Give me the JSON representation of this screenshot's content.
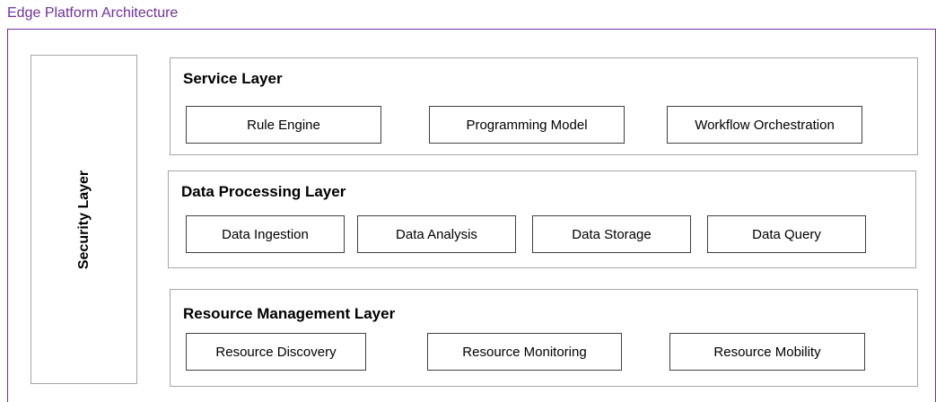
{
  "title": "Edge Platform Architecture",
  "colors": {
    "title": "#7030a0",
    "outer_border": "#7030a0",
    "layer_border": "#a6a6a6",
    "component_border": "#404040"
  },
  "security_layer": {
    "label": "Security Layer"
  },
  "layers": {
    "service": {
      "title": "Service Layer",
      "components": [
        "Rule Engine",
        "Programming Model",
        "Workflow Orchestration"
      ]
    },
    "data_processing": {
      "title": "Data Processing Layer",
      "components": [
        "Data Ingestion",
        "Data Analysis",
        "Data Storage",
        "Data Query"
      ]
    },
    "resource_management": {
      "title": "Resource Management Layer",
      "components": [
        "Resource Discovery",
        "Resource Monitoring",
        "Resource Mobility"
      ]
    }
  }
}
